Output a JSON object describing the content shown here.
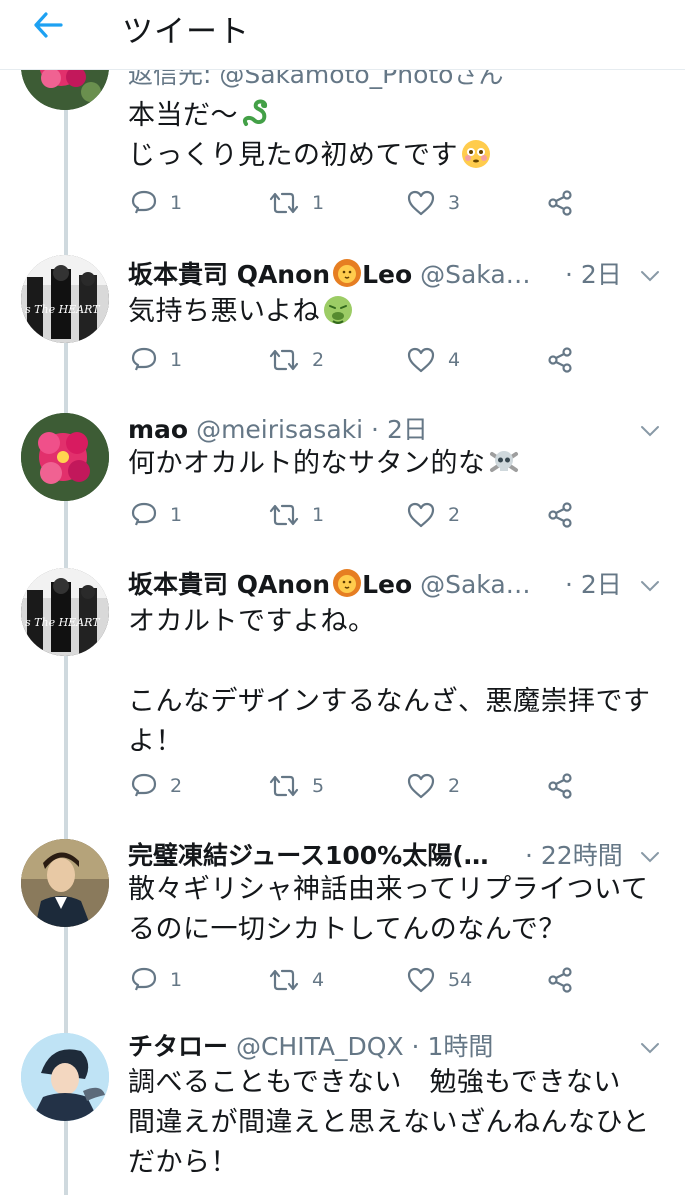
{
  "header": {
    "title": "ツイート"
  },
  "icons": {
    "back": "arrow-left-icon",
    "reply": "reply-icon",
    "retweet": "retweet-icon",
    "like": "heart-icon",
    "share": "share-icon",
    "caret": "chevron-down-icon"
  },
  "colors": {
    "accent": "#1da1f2",
    "muted": "#657786",
    "text": "#14171a",
    "divider": "#e6ecf0"
  },
  "tweets": [
    {
      "reply_to": "返信先: @Sakamoto_Photoさん",
      "lines": [
        "本当だ〜",
        "じっくり見たの初めてです"
      ],
      "replies": "1",
      "retweets": "1",
      "likes": "3"
    },
    {
      "name": "坂本貴司 QAnon",
      "name_suffix": "Leo",
      "handle": "@Saka…",
      "time": "· 2日",
      "lines": [
        "気持ち悪いよね"
      ],
      "replies": "1",
      "retweets": "2",
      "likes": "4"
    },
    {
      "name": "mao",
      "handle": "@meirisasaki",
      "time": "· 2日",
      "lines": [
        "何かオカルト的なサタン的な"
      ],
      "replies": "1",
      "retweets": "1",
      "likes": "2"
    },
    {
      "name": "坂本貴司 QAnon",
      "name_suffix": "Leo",
      "handle": "@Saka…",
      "time": "· 2日",
      "lines": [
        "オカルトですよね。",
        "",
        "こんなデザインするなんざ、悪魔崇拝です",
        "よ！"
      ],
      "replies": "2",
      "retweets": "5",
      "likes": "2"
    },
    {
      "name": "完璧凍結ジュース100%太陽(…",
      "handle": "",
      "time": "· 22時間",
      "lines": [
        "散々ギリシャ神話由来ってリプライついて",
        "るのに一切シカトしてんのなんで？"
      ],
      "replies": "1",
      "retweets": "4",
      "likes": "54"
    },
    {
      "name": "チタロー",
      "handle": "@CHITA_DQX",
      "time": "· 1時間",
      "lines": [
        "調べることもできない　勉強もできない",
        "間違えが間違えと思えないざんねんなひと",
        "だから！"
      ]
    }
  ]
}
